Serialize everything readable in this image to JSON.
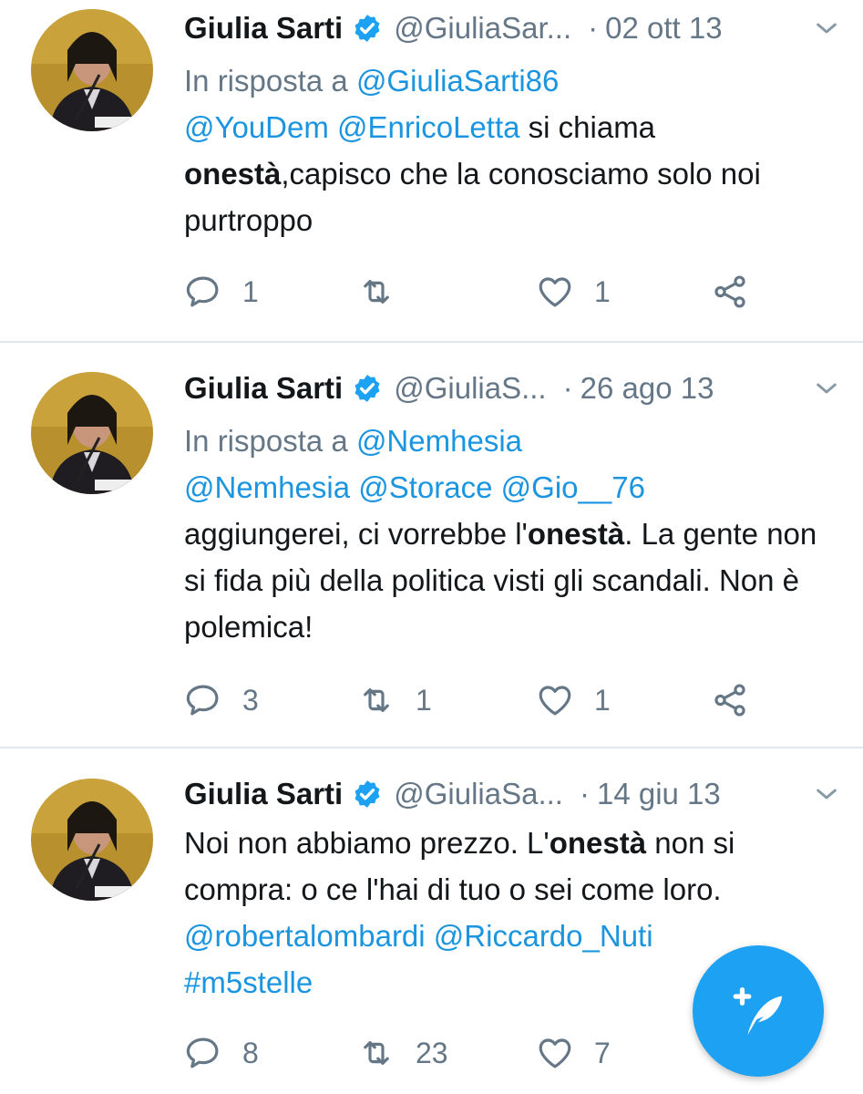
{
  "tweets": [
    {
      "name": "Giulia Sarti",
      "handle": "@GiuliaSar...",
      "date": "02 ott 13",
      "reply_label": "In risposta a",
      "reply_to": "@GiuliaSarti86",
      "mention1": "@YouDem",
      "mention2": "@EnricoLetta",
      "text_a": " si chiama",
      "bold": "onestà",
      "text_b": ",capisco che la conosciamo solo noi purtroppo",
      "replies": "1",
      "retweets": "",
      "likes": "1"
    },
    {
      "name": "Giulia Sarti",
      "handle": "@GiuliaS...",
      "date": "26 ago 13",
      "reply_label": "In risposta a",
      "reply_to": "@Nemhesia",
      "mention1": "@Nemhesia",
      "mention2": "@Storace",
      "mention3": "@Gio__76",
      "text_a": "aggiungerei, ci vorrebbe l'",
      "bold": "onestà",
      "text_b": ".  La gente non si fida più della politica visti gli scandali. Non è polemica!",
      "replies": "3",
      "retweets": "1",
      "likes": "1"
    },
    {
      "name": "Giulia Sarti",
      "handle": "@GiuliaSa...",
      "date": "14 giu 13",
      "text_a": "Noi non abbiamo prezzo. L'",
      "bold": "onestà",
      "text_b": " non si compra: o ce l'hai di tuo o sei come loro.",
      "mention1": "@robertalombardi",
      "mention2": "@Riccardo_Nuti",
      "hashtag": "#m5stelle",
      "replies": "8",
      "retweets": "23",
      "likes": "7"
    }
  ],
  "separator_dot": "·",
  "colors": {
    "link": "#1b95e0",
    "muted": "#657786",
    "fab": "#1da1f2",
    "verified": "#1da1f2"
  },
  "icons": [
    "reply-icon",
    "retweet-icon",
    "like-icon",
    "share-icon",
    "verified-icon",
    "chevron-down-icon",
    "compose-tweet-icon"
  ]
}
